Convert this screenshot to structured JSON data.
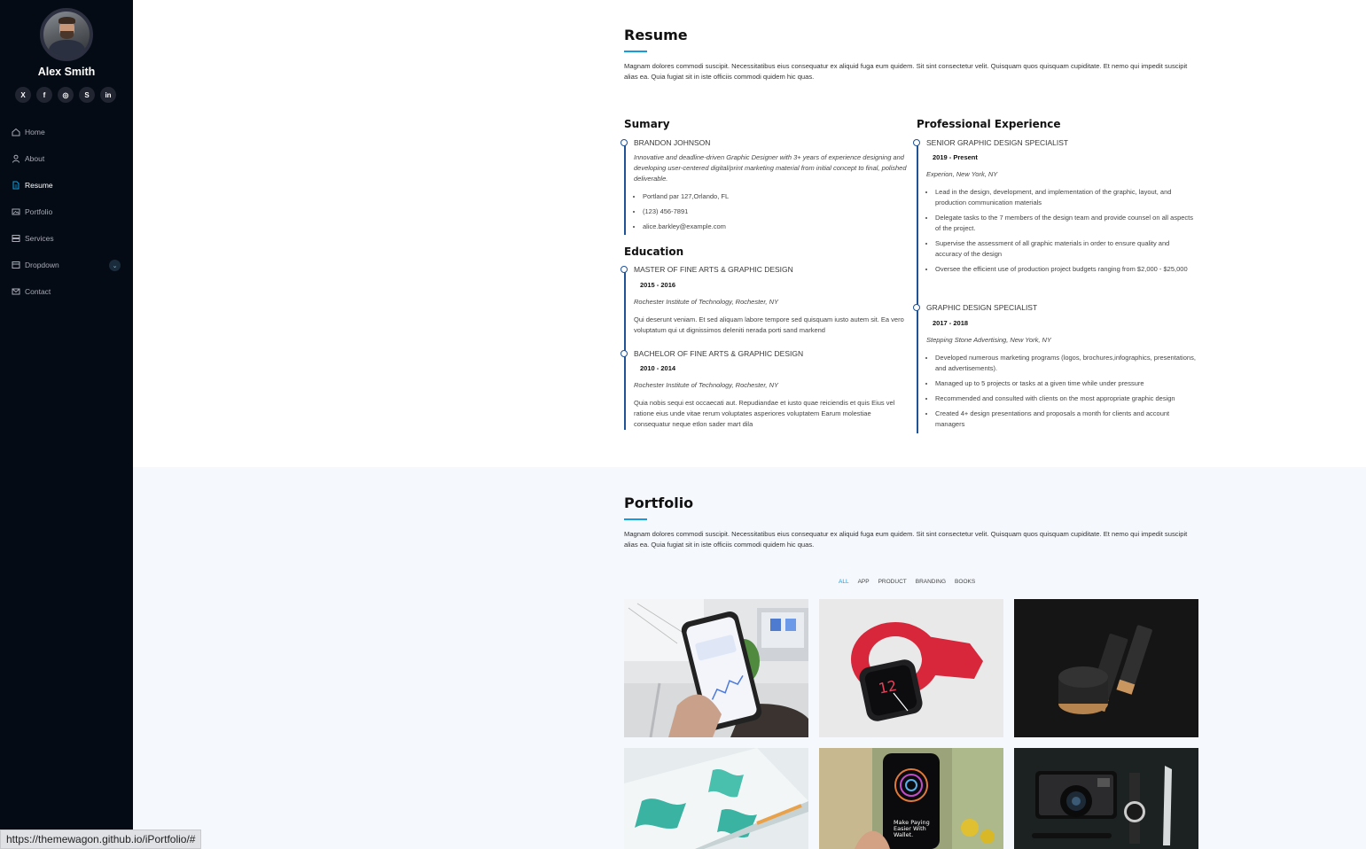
{
  "sidebar": {
    "name": "Alex Smith",
    "social_icons": [
      "x-icon",
      "facebook-icon",
      "instagram-icon",
      "skype-icon",
      "linkedin-icon"
    ],
    "social_labels": [
      "X",
      "f",
      "◎",
      "S",
      "in"
    ],
    "nav": [
      {
        "label": "Home",
        "icon": "home-icon"
      },
      {
        "label": "About",
        "icon": "person-icon"
      },
      {
        "label": "Resume",
        "icon": "file-icon",
        "active": true
      },
      {
        "label": "Portfolio",
        "icon": "images-icon"
      },
      {
        "label": "Services",
        "icon": "hdd-stack-icon"
      },
      {
        "label": "Dropdown",
        "icon": "menu-icon",
        "chevron": true
      },
      {
        "label": "Contact",
        "icon": "envelope-icon"
      }
    ]
  },
  "resume": {
    "title": "Resume",
    "intro": "Magnam dolores commodi suscipit. Necessitatibus eius consequatur ex aliquid fuga eum quidem. Sit sint consectetur velit. Quisquam quos quisquam cupiditate. Et nemo qui impedit suscipit alias ea. Quia fugiat sit in iste officiis commodi quidem hic quas.",
    "summary": {
      "heading": "Sumary",
      "name": "BRANDON JOHNSON",
      "text": "Innovative and deadline-driven Graphic Designer with 3+ years of experience designing and developing user-centered digital/print marketing material from initial concept to final, polished deliverable.",
      "contacts": [
        "Portland par 127,Orlando, FL",
        "(123) 456-7891",
        "alice.barkley@example.com"
      ]
    },
    "education": {
      "heading": "Education",
      "items": [
        {
          "title": "MASTER OF FINE ARTS & GRAPHIC DESIGN",
          "date": "2015 - 2016",
          "place": "Rochester Institute of Technology, Rochester, NY",
          "text": "Qui deserunt veniam. Et sed aliquam labore tempore sed quisquam iusto autem sit. Ea vero voluptatum qui ut dignissimos deleniti nerada porti sand markend"
        },
        {
          "title": "BACHELOR OF FINE ARTS & GRAPHIC DESIGN",
          "date": "2010 - 2014",
          "place": "Rochester Institute of Technology, Rochester, NY",
          "text": "Quia nobis sequi est occaecati aut. Repudiandae et iusto quae reiciendis et quis Eius vel ratione eius unde vitae rerum voluptates asperiores voluptatem Earum molestiae consequatur neque etlon sader mart dila"
        }
      ]
    },
    "experience": {
      "heading": "Professional Experience",
      "items": [
        {
          "title": "SENIOR GRAPHIC DESIGN SPECIALIST",
          "date": "2019 - Present",
          "place": "Experion, New York, NY",
          "bullets": [
            "Lead in the design, development, and implementation of the graphic, layout, and production communication materials",
            "Delegate tasks to the 7 members of the design team and provide counsel on all aspects of the project.",
            "Supervise the assessment of all graphic materials in order to ensure quality and accuracy of the design",
            "Oversee the efficient use of production project budgets ranging from $2,000 - $25,000"
          ]
        },
        {
          "title": "GRAPHIC DESIGN SPECIALIST",
          "date": "2017 - 2018",
          "place": "Stepping Stone Advertising, New York, NY",
          "bullets": [
            "Developed numerous marketing programs (logos, brochures,infographics, presentations, and advertisements).",
            "Managed up to 5 projects or tasks at a given time while under pressure",
            "Recommended and consulted with clients on the most appropriate graphic design",
            "Created 4+ design presentations and proposals a month for clients and account managers"
          ]
        }
      ]
    }
  },
  "portfolio": {
    "title": "Portfolio",
    "intro": "Magnam dolores commodi suscipit. Necessitatibus eius consequatur ex aliquid fuga eum quidem. Sit sint consectetur velit. Quisquam quos quisquam cupiditate. Et nemo qui impedit suscipit alias ea. Quia fugiat sit in iste officiis commodi quidem hic quas.",
    "filters": [
      "ALL",
      "APP",
      "PRODUCT",
      "BRANDING",
      "BOOKS"
    ],
    "items": [
      {
        "name": "app-1",
        "icon": "phone-in-hand-image"
      },
      {
        "name": "product-1",
        "icon": "smartwatch-image"
      },
      {
        "name": "branding-1",
        "icon": "cosmetic-jars-image"
      },
      {
        "name": "books-1",
        "icon": "book-cover-image"
      },
      {
        "name": "app-2",
        "icon": "phone-screen-image"
      },
      {
        "name": "product-2",
        "icon": "camera-watch-image"
      }
    ],
    "app2_screen_text": "Make Paying Easier With Wallet."
  },
  "statusbar": {
    "url": "https://themewagon.github.io/iPortfolio/#"
  },
  "colors": {
    "accent": "#149ddd",
    "sidebar_bg": "#040b14",
    "timeline": "#1f5297",
    "section_alt_bg": "#f5f8fd"
  }
}
